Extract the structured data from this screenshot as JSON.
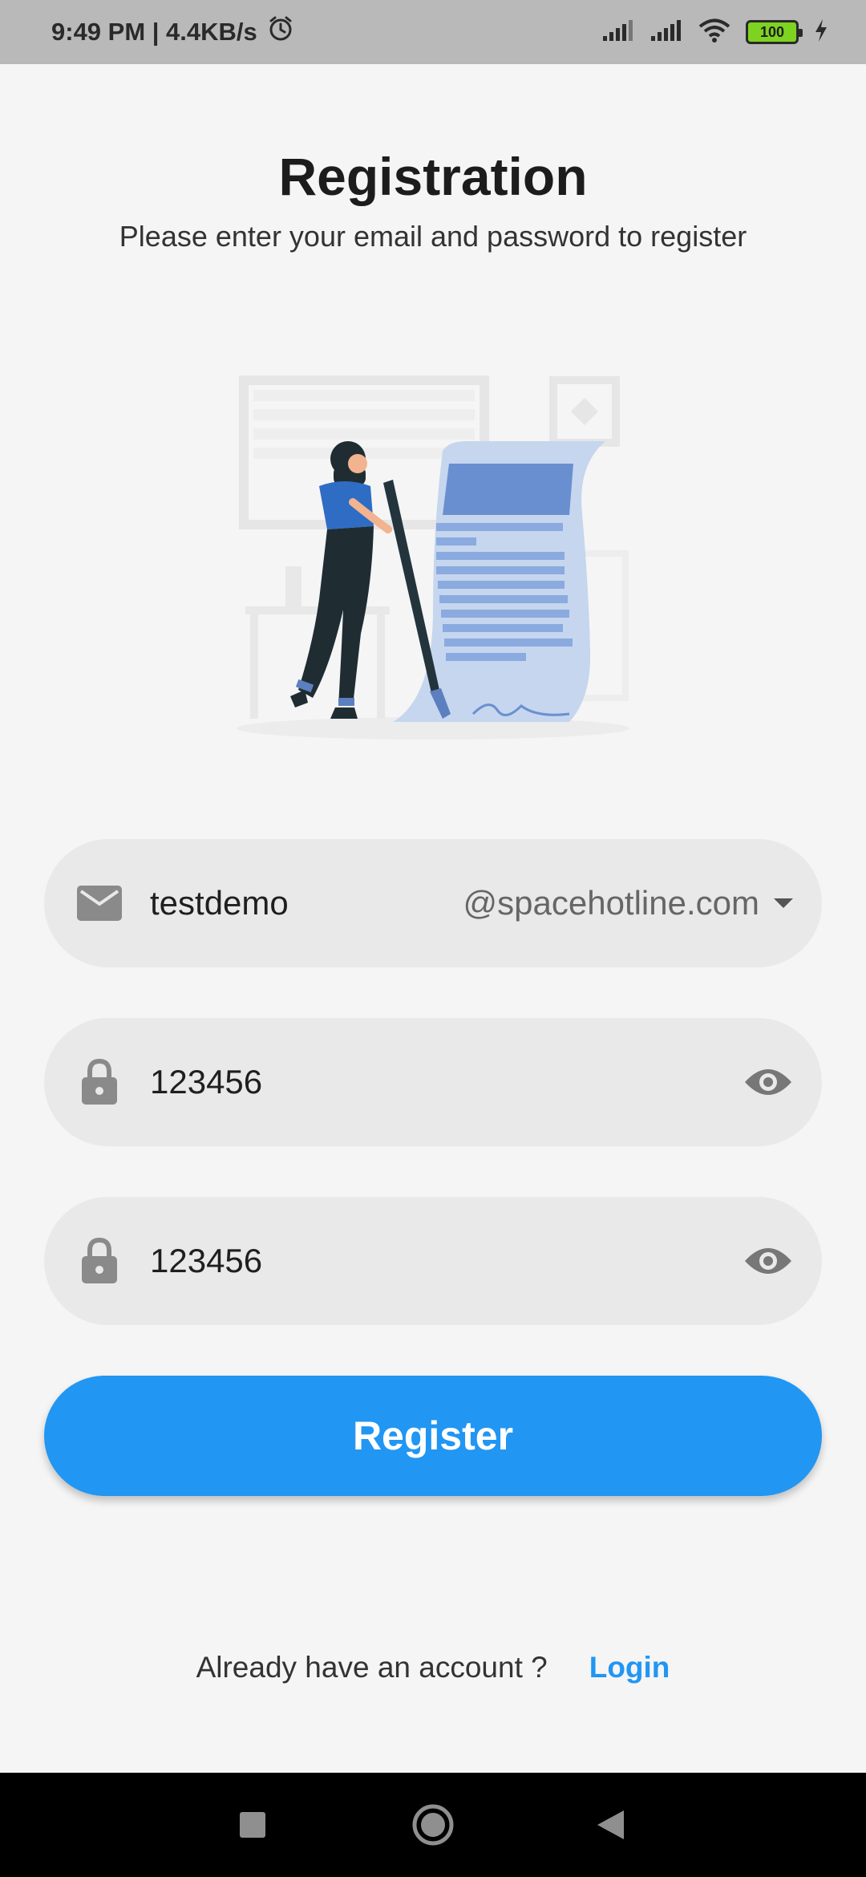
{
  "status_bar": {
    "time_speed": "9:49 PM | 4.4KB/s",
    "battery_level": "100",
    "icons": [
      "alarm-icon",
      "signal-icon",
      "signal-icon",
      "wifi-icon",
      "battery-icon",
      "charging-icon"
    ]
  },
  "header": {
    "title": "Registration",
    "subtitle": "Please enter your email and password to register"
  },
  "form": {
    "email": {
      "icon": "mail-icon",
      "value": "testdemo",
      "domain": "@spacehotline.com",
      "dropdown_icon": "dropdown-arrow-icon"
    },
    "password": {
      "icon": "lock-icon",
      "value": "123456",
      "toggle_icon": "eye-icon"
    },
    "confirm_password": {
      "icon": "lock-icon",
      "value": "123456",
      "toggle_icon": "eye-icon"
    },
    "register_label": "Register"
  },
  "footer": {
    "question": "Already have an account ?",
    "login_label": "Login"
  },
  "colors": {
    "accent": "#2196f3",
    "background": "#f5f5f5",
    "field_background": "#e9e9e9",
    "status_bar": "#b9b9b9"
  }
}
